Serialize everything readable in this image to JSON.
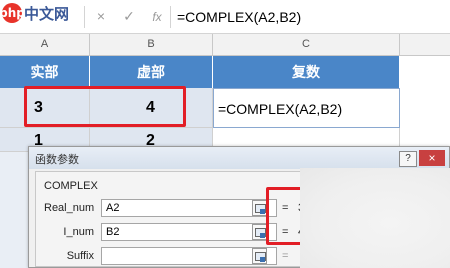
{
  "app": {
    "logo_mark": "php",
    "logo_text": "中文网"
  },
  "formula_bar": {
    "cancel_icon": "×",
    "confirm_icon": "✓",
    "function_icon": "fx",
    "formula": "=COMPLEX(A2,B2)"
  },
  "columns": [
    "A",
    "B",
    "C"
  ],
  "table": {
    "headers": [
      "实部",
      "虚部",
      "复数"
    ],
    "row2": {
      "a": "3",
      "b": "4",
      "c": "=COMPLEX(A2,B2)"
    },
    "row3": {
      "a": "1",
      "b": "2"
    }
  },
  "dialog": {
    "title": "函数参数",
    "help_label": "?",
    "close_label": "×",
    "function_name": "COMPLEX",
    "args": [
      {
        "label": "Real_num",
        "value": "A2",
        "eq": "=",
        "result": "3"
      },
      {
        "label": "I_num",
        "value": "B2",
        "eq": "=",
        "result": "4"
      },
      {
        "label": "Suffix",
        "value": "",
        "eq": "=",
        "result": ""
      }
    ]
  },
  "colors": {
    "header_fill": "#4a86c8",
    "highlight": "#e21e26",
    "logo_red": "#e8332a"
  }
}
